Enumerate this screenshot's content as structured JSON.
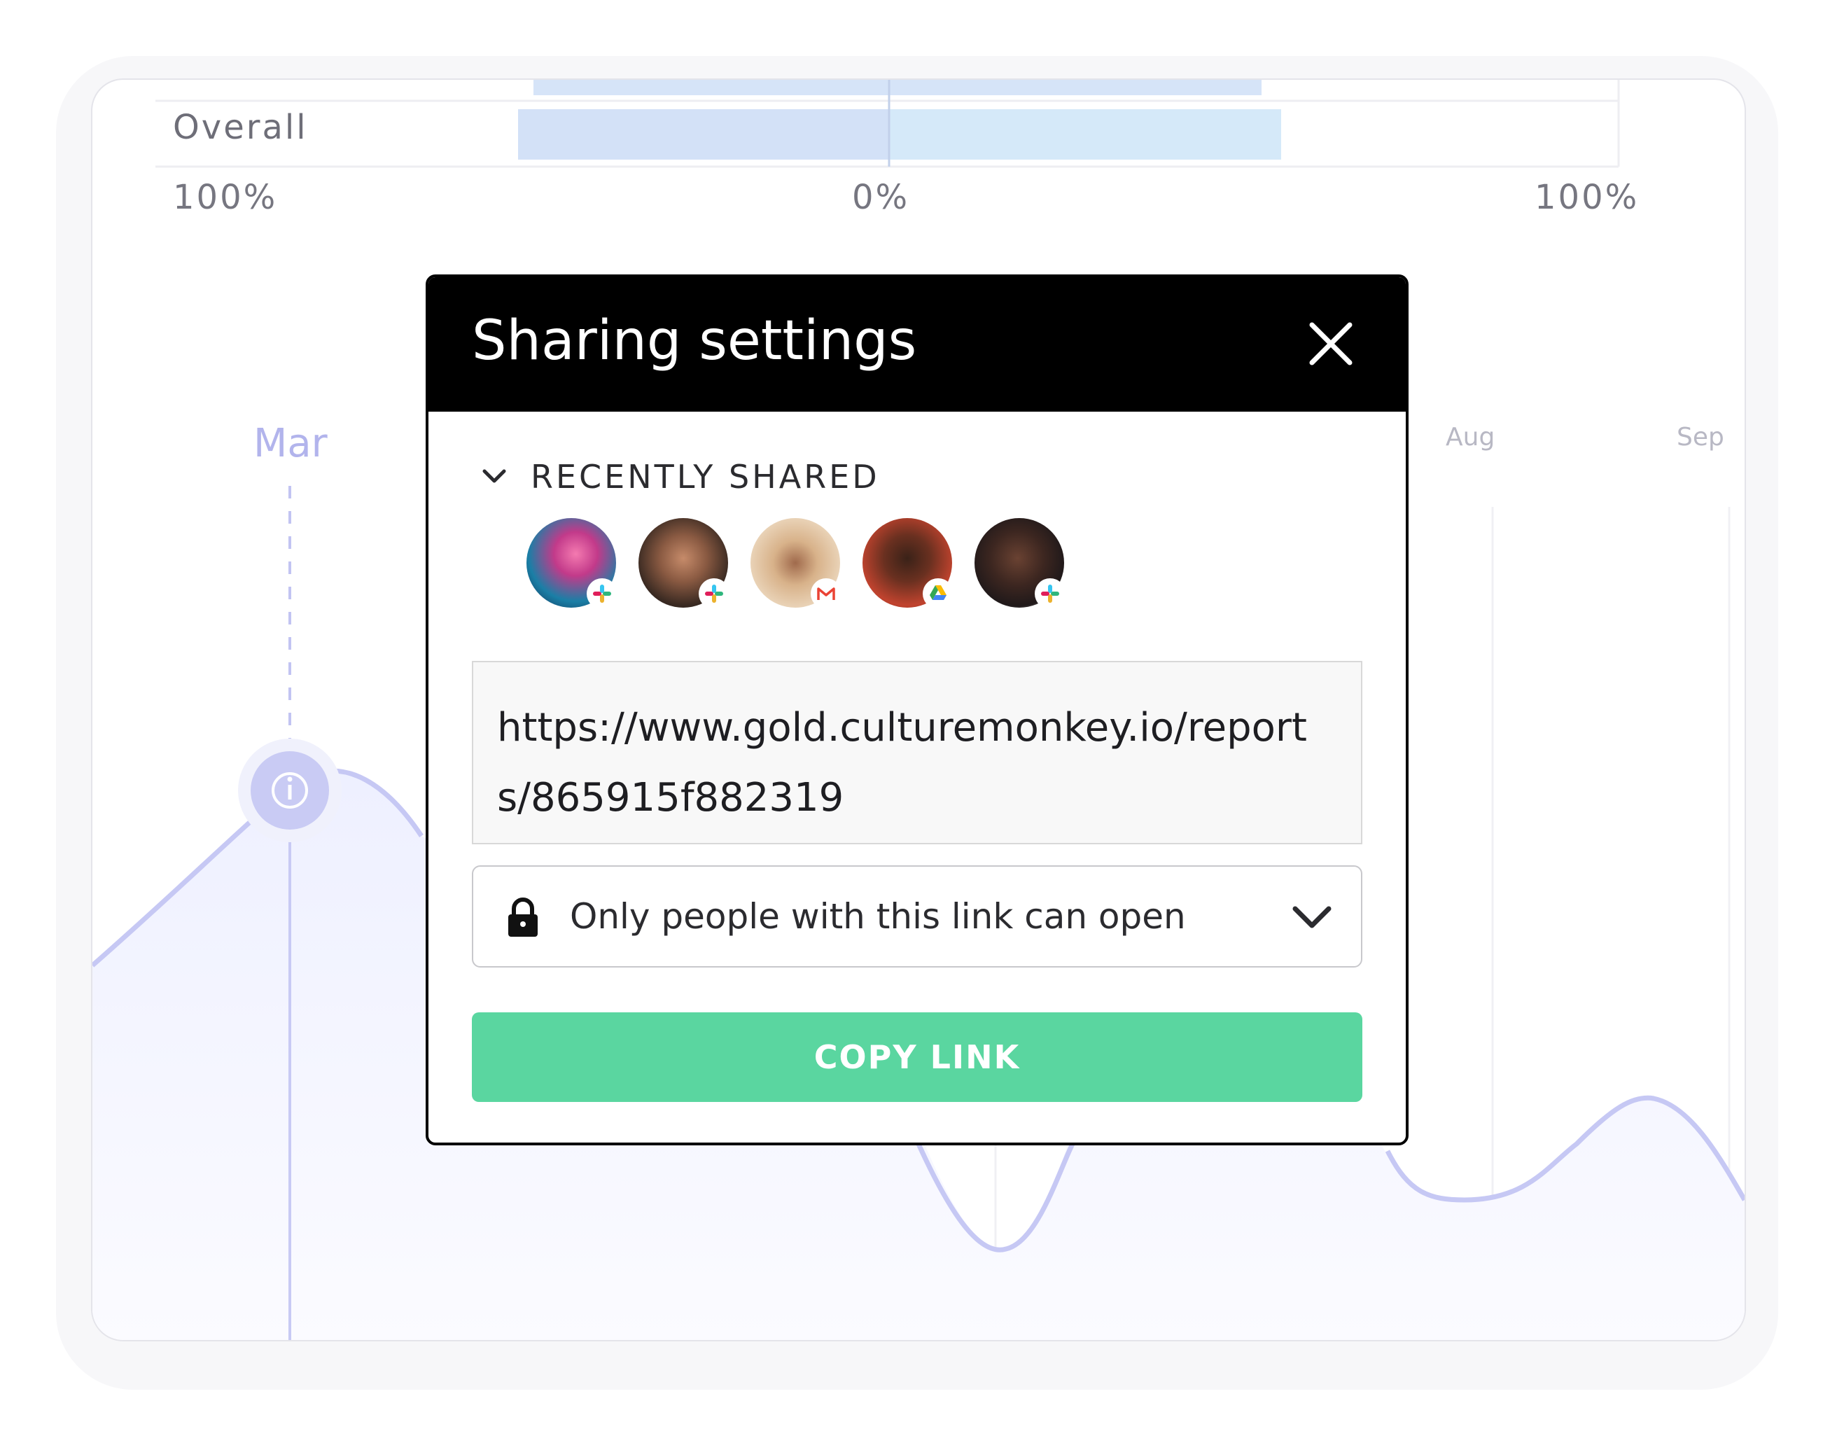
{
  "chart": {
    "row_label": "Overall",
    "axis_left": "100%",
    "axis_center": "0%",
    "axis_right": "100%",
    "months": {
      "active": "Mar",
      "aug": "Aug",
      "sep": "Sep"
    },
    "colors": {
      "line": "#c6c8f4",
      "fill": "#f4f5ff",
      "bar_left": "#d3e1f7",
      "bar_right": "#d5e9f9"
    }
  },
  "modal": {
    "title": "Sharing settings",
    "close_icon": "close-icon",
    "section_label": "RECENTLY SHARED",
    "avatars": [
      {
        "name": "avatar-1",
        "badge": "slack-icon"
      },
      {
        "name": "avatar-2",
        "badge": "slack-icon"
      },
      {
        "name": "avatar-3",
        "badge": "gmail-icon"
      },
      {
        "name": "avatar-4",
        "badge": "google-drive-icon"
      },
      {
        "name": "avatar-5",
        "badge": "slack-icon"
      }
    ],
    "url": "https://www.gold.culturemonkey.io/reports/865915f882319",
    "access_option": "Only people with this link can open",
    "copy_label": "COPY LINK",
    "colors": {
      "header": "#000000",
      "button": "#5ad6a0"
    }
  }
}
